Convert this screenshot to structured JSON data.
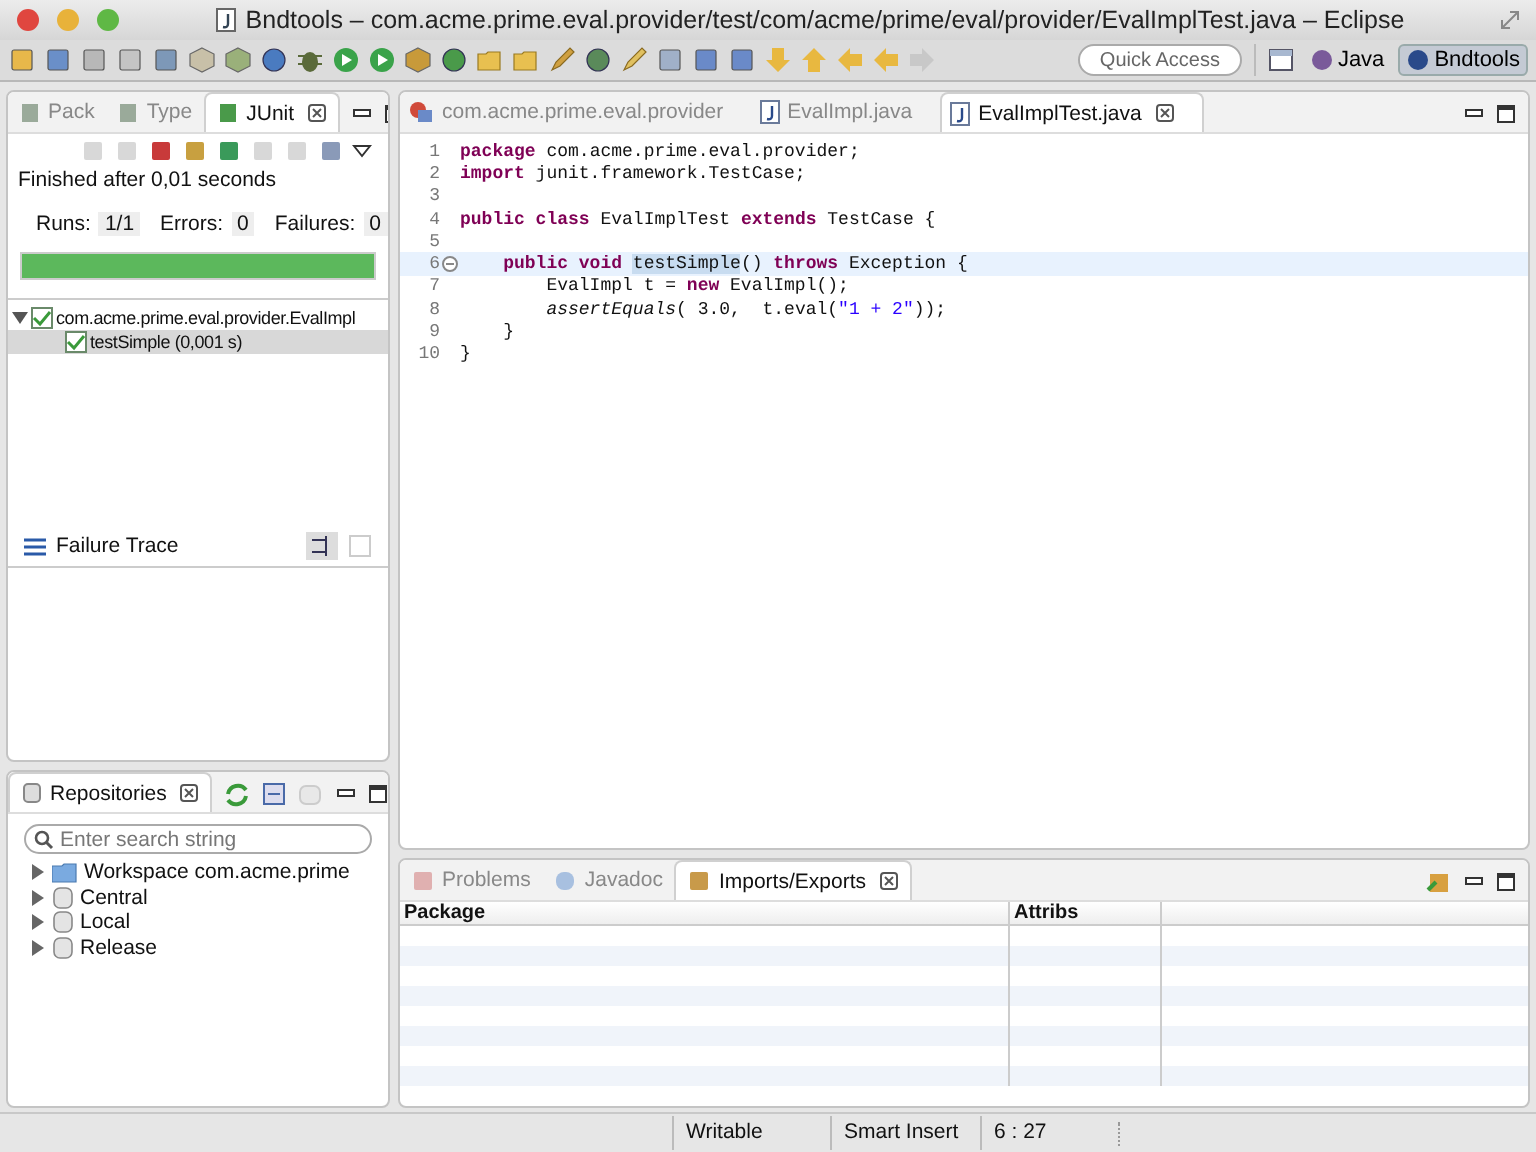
{
  "window": {
    "title": "Bndtools – com.acme.prime.eval.provider/test/com/acme/prime/eval/provider/EvalImplTest.java – Eclipse"
  },
  "toolbar": {
    "quick_access": {
      "placeholder": "Quick Access"
    },
    "perspectives": [
      {
        "label": "Java",
        "selected": false
      },
      {
        "label": "Bndtools",
        "selected": true
      }
    ]
  },
  "left_tabs": [
    {
      "label": "Pack",
      "selected": false
    },
    {
      "label": "Type",
      "selected": false
    },
    {
      "label": "JUnit",
      "selected": true
    }
  ],
  "junit": {
    "status": "Finished after 0,01 seconds",
    "runs_label": "Runs:",
    "runs": "1/1",
    "errors_label": "Errors:",
    "errors": "0",
    "failures_label": "Failures:",
    "failures": "0",
    "level": 1,
    "tree": [
      {
        "label": "com.acme.prime.eval.provider.EvalImpl",
        "expanded": true,
        "selected": false,
        "children": [
          {
            "label": "testSimple (0,001 s)",
            "selected": true
          }
        ]
      }
    ],
    "failure_trace": "Failure Trace"
  },
  "repositories": {
    "title": "Repositories",
    "search": {
      "placeholder": "Enter search string"
    },
    "items": [
      {
        "label": "Workspace com.acme.prime",
        "kind": "folder",
        "expanded": false
      },
      {
        "label": "Central",
        "kind": "repository",
        "expanded": false
      },
      {
        "label": "Local",
        "kind": "repository",
        "expanded": false
      },
      {
        "label": "Release",
        "kind": "repository",
        "expanded": false
      }
    ]
  },
  "editor_tabs": [
    {
      "label": "com.acme.prime.eval.provider",
      "kind": "project",
      "selected": false
    },
    {
      "label": "EvalImpl.java",
      "kind": "java",
      "selected": false
    },
    {
      "label": "EvalImplTest.java",
      "kind": "java",
      "selected": true
    }
  ],
  "editor": {
    "lines": [
      {
        "number": "1",
        "current": false,
        "segments": [
          {
            "text": "package",
            "kind": "keyword"
          },
          {
            "text": " com.acme.prime.eval.provider;",
            "kind": "plain"
          }
        ]
      },
      {
        "number": "2",
        "current": false,
        "segments": [
          {
            "text": "import",
            "kind": "keyword"
          },
          {
            "text": " junit.framework.TestCase;",
            "kind": "plain"
          }
        ]
      },
      {
        "number": "3",
        "current": false
      },
      {
        "number": "4",
        "current": false,
        "segments": [
          {
            "text": "public class",
            "kind": "keyword"
          },
          {
            "text": " EvalImplTest ",
            "kind": "plain"
          },
          {
            "text": "extends",
            "kind": "keyword"
          },
          {
            "text": " TestCase {",
            "kind": "plain"
          }
        ]
      },
      {
        "number": "5",
        "current": false
      },
      {
        "number": "6",
        "current": true,
        "folding": true,
        "segments": [
          {
            "text": "    public void ",
            "kind": "keyword"
          },
          {
            "text": "testSimple",
            "kind": "occurrence"
          },
          {
            "text": "() ",
            "kind": "plain"
          },
          {
            "text": "throws",
            "kind": "keyword"
          },
          {
            "text": " Exception {",
            "kind": "plain"
          }
        ]
      },
      {
        "number": "7",
        "current": false,
        "segments": [
          {
            "text": "        EvalImpl t = ",
            "kind": "plain"
          },
          {
            "text": "new",
            "kind": "keyword"
          },
          {
            "text": " EvalImpl();",
            "kind": "plain"
          }
        ]
      },
      {
        "number": "8",
        "current": false,
        "segments": [
          {
            "text": "        assertEquals",
            "kind": "italic"
          },
          {
            "text": "( 3.0,  t.eval(",
            "kind": "plain"
          },
          {
            "text": "\"1 + 2\"",
            "kind": "string"
          },
          {
            "text": "));",
            "kind": "plain"
          }
        ]
      },
      {
        "number": "9",
        "current": false,
        "segments": [
          {
            "text": "    }",
            "kind": "plain"
          }
        ]
      },
      {
        "number": "10",
        "current": false,
        "segments": [
          {
            "text": "}",
            "kind": "plain"
          }
        ]
      }
    ]
  },
  "bottom_tabs": [
    {
      "label": "Problems",
      "selected": false
    },
    {
      "label": "Javadoc",
      "selected": false
    },
    {
      "label": "Imports/Exports",
      "selected": true
    }
  ],
  "imports_table": {
    "columns": [
      "Package",
      "Attribs"
    ]
  },
  "status_bar": [
    "Writable",
    "Smart Insert",
    "6 : 27"
  ]
}
